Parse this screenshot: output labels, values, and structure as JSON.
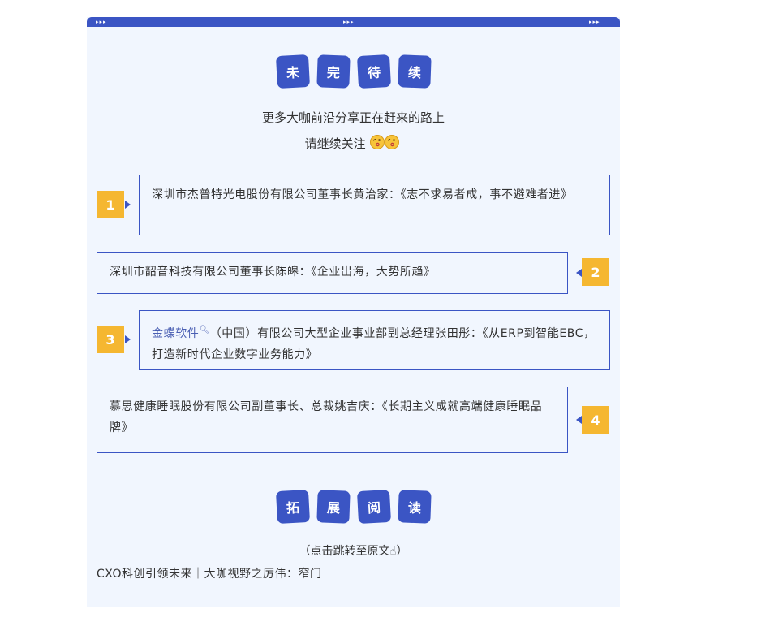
{
  "header": {
    "arrows": "▸▸▸",
    "tiles": [
      "未",
      "完",
      "待",
      "续"
    ],
    "line1": "更多大咖前沿分享正在赶来的路上",
    "line2": "请继续关注",
    "line2_emoji": "wink-kiss-emoji"
  },
  "items": [
    {
      "num": "1",
      "text": "深圳市杰普特光电股份有限公司董事长黄治家：《志不求易者成，事不避难者进》"
    },
    {
      "num": "2",
      "text": "深圳市韶音科技有限公司董事长陈皞：《企业出海，大势所趋》"
    },
    {
      "num": "3",
      "link_text": "金蝶软件",
      "link_icon": "search-icon",
      "text": "（中国）有限公司大型企业事业部副总经理张田彤：《从ERP到智能EBC，打造新时代企业数字业务能力》"
    },
    {
      "num": "4",
      "text": "慕思健康睡眠股份有限公司副董事长、总裁姚吉庆：《长期主义成就高端健康睡眠品牌》"
    }
  ],
  "footer": {
    "tiles": [
      "拓",
      "展",
      "阅",
      "读"
    ],
    "hint_prefix": "（点击跳转至原文",
    "hint_icon": "pointer-hand-icon",
    "hint_suffix": "）",
    "link": "CXO科创引领未来｜大咖视野之厉伟：窄门"
  },
  "colors": {
    "accent": "#3b55c4",
    "badge": "#f5b731",
    "background": "#f1f6fe"
  }
}
